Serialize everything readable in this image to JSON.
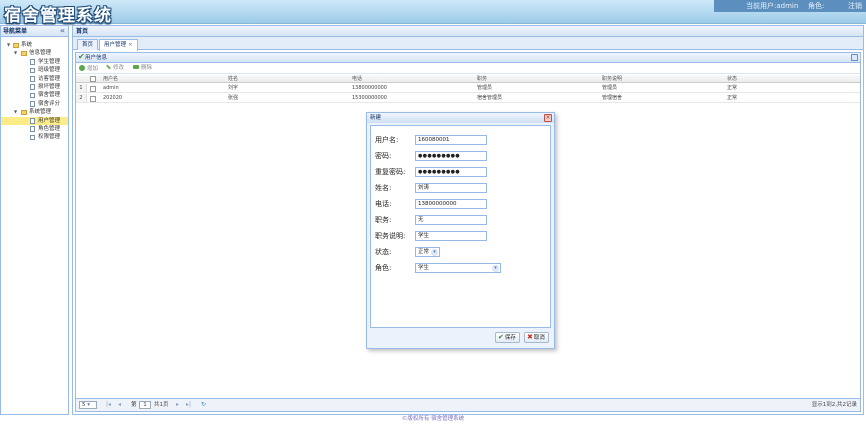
{
  "header": {
    "logo": "宿舍管理系统",
    "current_user_label": "当前用户:admin",
    "role_label": "角色:",
    "logout": "注销"
  },
  "nav": {
    "title": "导航菜单",
    "collapse_icon": "«",
    "items": [
      {
        "label": "系统",
        "type": "folder",
        "level": 0
      },
      {
        "label": "信息管理",
        "type": "folder",
        "level": 1
      },
      {
        "label": "学生管理",
        "type": "file",
        "level": 2
      },
      {
        "label": "班级管理",
        "type": "file",
        "level": 2
      },
      {
        "label": "访客管理",
        "type": "file",
        "level": 2
      },
      {
        "label": "损坏管理",
        "type": "file",
        "level": 2
      },
      {
        "label": "宿舍管理",
        "type": "file",
        "level": 2
      },
      {
        "label": "宿舍评分",
        "type": "file",
        "level": 2
      },
      {
        "label": "系统管理",
        "type": "folder",
        "level": 1
      },
      {
        "label": "用户管理",
        "type": "file",
        "level": 2,
        "selected": true
      },
      {
        "label": "角色管理",
        "type": "file",
        "level": 2
      },
      {
        "label": "权限管理",
        "type": "file",
        "level": 2
      }
    ]
  },
  "main": {
    "title": "首页",
    "tabs": [
      {
        "label": "首页"
      },
      {
        "label": "用户管理",
        "close": "×"
      }
    ]
  },
  "panel": {
    "title": "用户信息",
    "toolbar": {
      "add": "增加",
      "edit": "修改",
      "delete": "删除"
    },
    "columns": [
      "用户名",
      "姓名",
      "电话",
      "职务",
      "职务说明",
      "状态"
    ],
    "rows": [
      {
        "num": "1",
        "username": "admin",
        "name": "刘宇",
        "phone": "13800000000",
        "job": "管理员",
        "job_desc": "管理员",
        "status": "正常"
      },
      {
        "num": "2",
        "username": "202020",
        "name": "张强",
        "phone": "15300000000",
        "job": "宿舍管理员",
        "job_desc": "管理宿舍",
        "status": "正常"
      }
    ]
  },
  "pager": {
    "page_size": "5",
    "page_prefix": "第",
    "page_value": "1",
    "page_suffix": "共1页",
    "display": "显示1到2,共2记录"
  },
  "footer": "©版权所有 宿舍管理系统",
  "dialog": {
    "title": "新建",
    "close_icon": "×",
    "fields": {
      "username": {
        "label": "用户名:",
        "value": "160080001"
      },
      "password": {
        "label": "密码:",
        "value": "●●●●●●●●●"
      },
      "confirm_password": {
        "label": "重复密码:",
        "value": "●●●●●●●●●"
      },
      "name": {
        "label": "姓名:",
        "value": "刘涛"
      },
      "phone": {
        "label": "电话:",
        "value": "13800000000"
      },
      "job": {
        "label": "职务:",
        "value": "无"
      },
      "job_desc": {
        "label": "职务说明:",
        "value": "学生"
      },
      "status": {
        "label": "状态:",
        "value": "正常"
      },
      "role": {
        "label": "角色:",
        "value": "学生"
      }
    },
    "save": "保存",
    "cancel": "取消"
  },
  "colors": {
    "accent": "#99bbe8",
    "header": "#9ccce9",
    "selected": "#fbec88"
  }
}
